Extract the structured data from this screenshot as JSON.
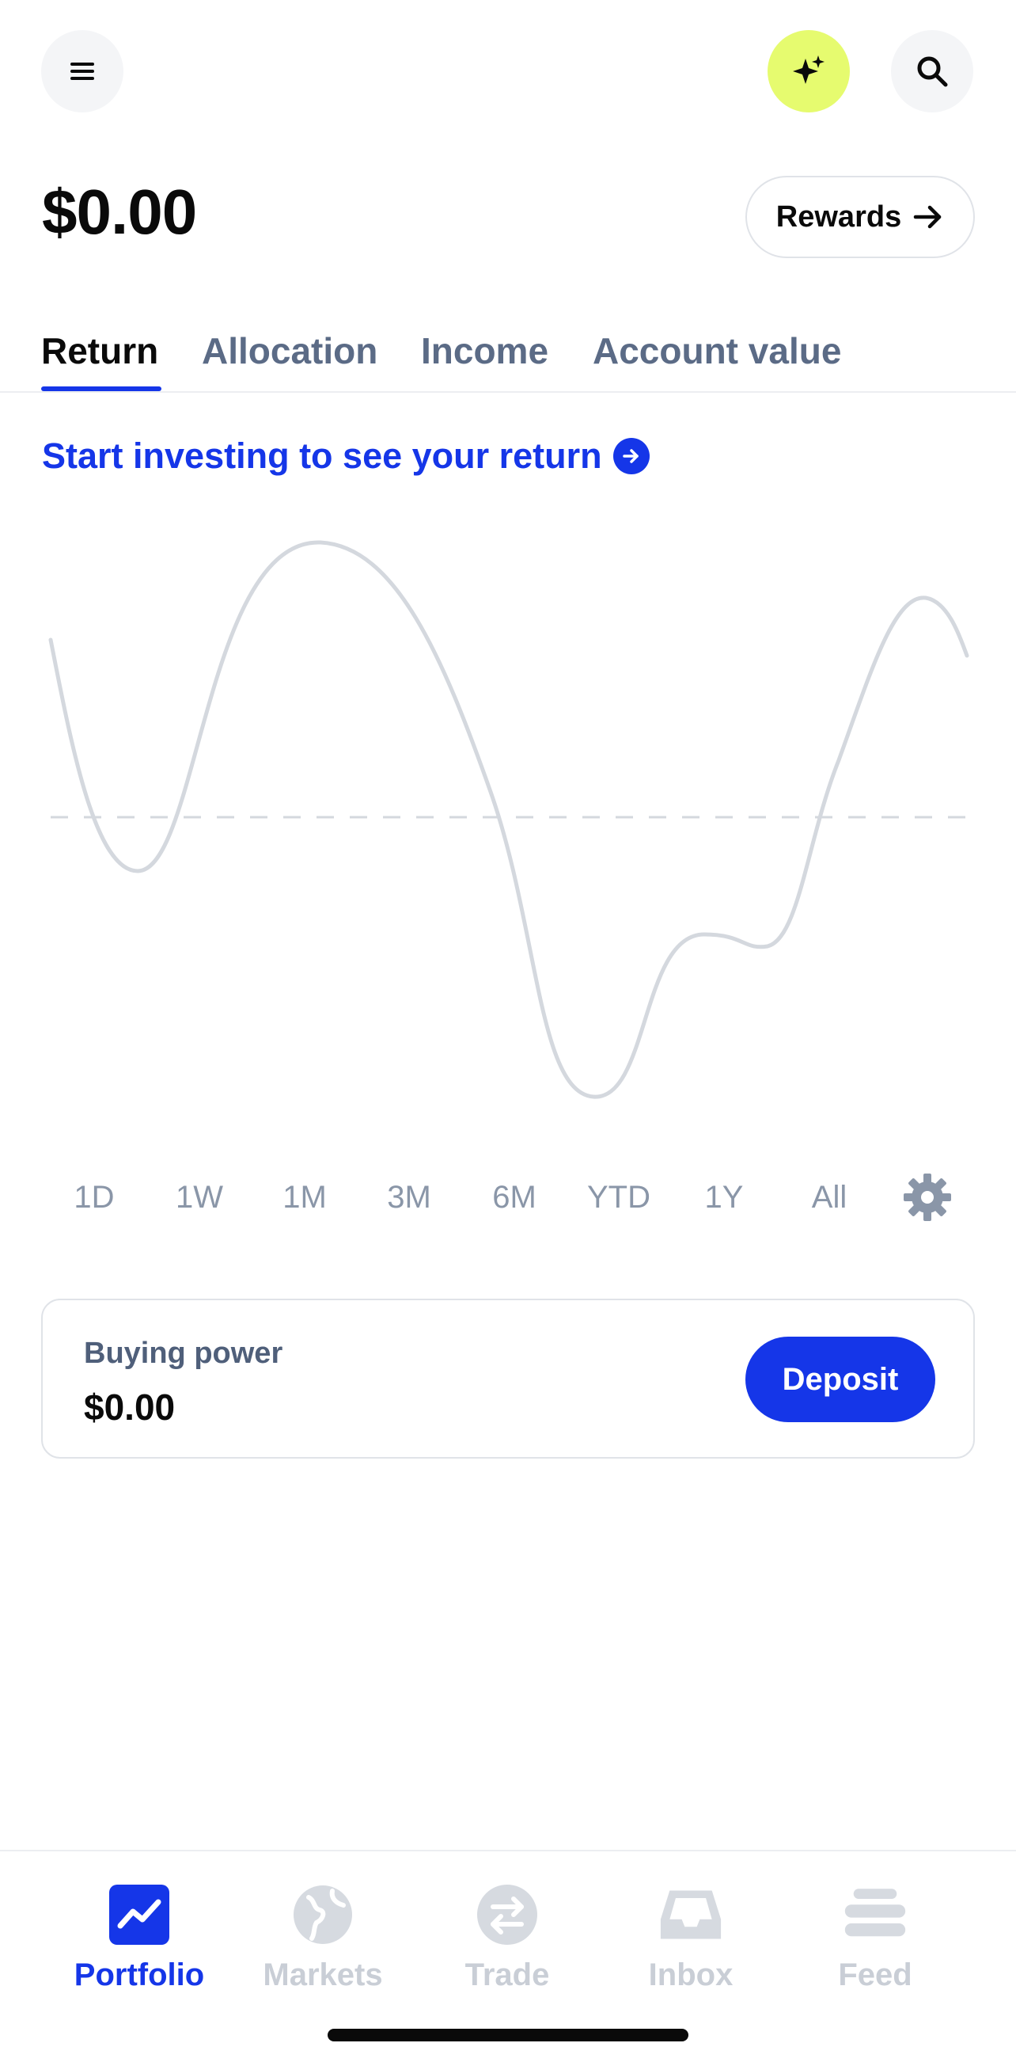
{
  "header": {
    "balance": "$0.00",
    "rewards_label": "Rewards"
  },
  "tabs": [
    {
      "label": "Return",
      "active": true
    },
    {
      "label": "Allocation",
      "active": false
    },
    {
      "label": "Income",
      "active": false
    },
    {
      "label": "Account value",
      "active": false
    }
  ],
  "cta": {
    "text": "Start investing to see your return"
  },
  "ranges": [
    "1D",
    "1W",
    "1M",
    "3M",
    "6M",
    "YTD",
    "1Y",
    "All"
  ],
  "buying_power": {
    "label": "Buying power",
    "value": "$0.00",
    "deposit_label": "Deposit"
  },
  "nav": [
    {
      "label": "Portfolio",
      "icon": "portfolio-chart-icon",
      "active": true
    },
    {
      "label": "Markets",
      "icon": "globe-icon",
      "active": false
    },
    {
      "label": "Trade",
      "icon": "swap-arrows-icon",
      "active": false
    },
    {
      "label": "Inbox",
      "icon": "inbox-tray-icon",
      "active": false
    },
    {
      "label": "Feed",
      "icon": "feed-stack-icon",
      "active": false
    }
  ],
  "colors": {
    "accent": "#1536e8",
    "ai_button": "#e6fb6f",
    "muted": "#8a96a8",
    "placeholder_line": "#d4d8de"
  }
}
